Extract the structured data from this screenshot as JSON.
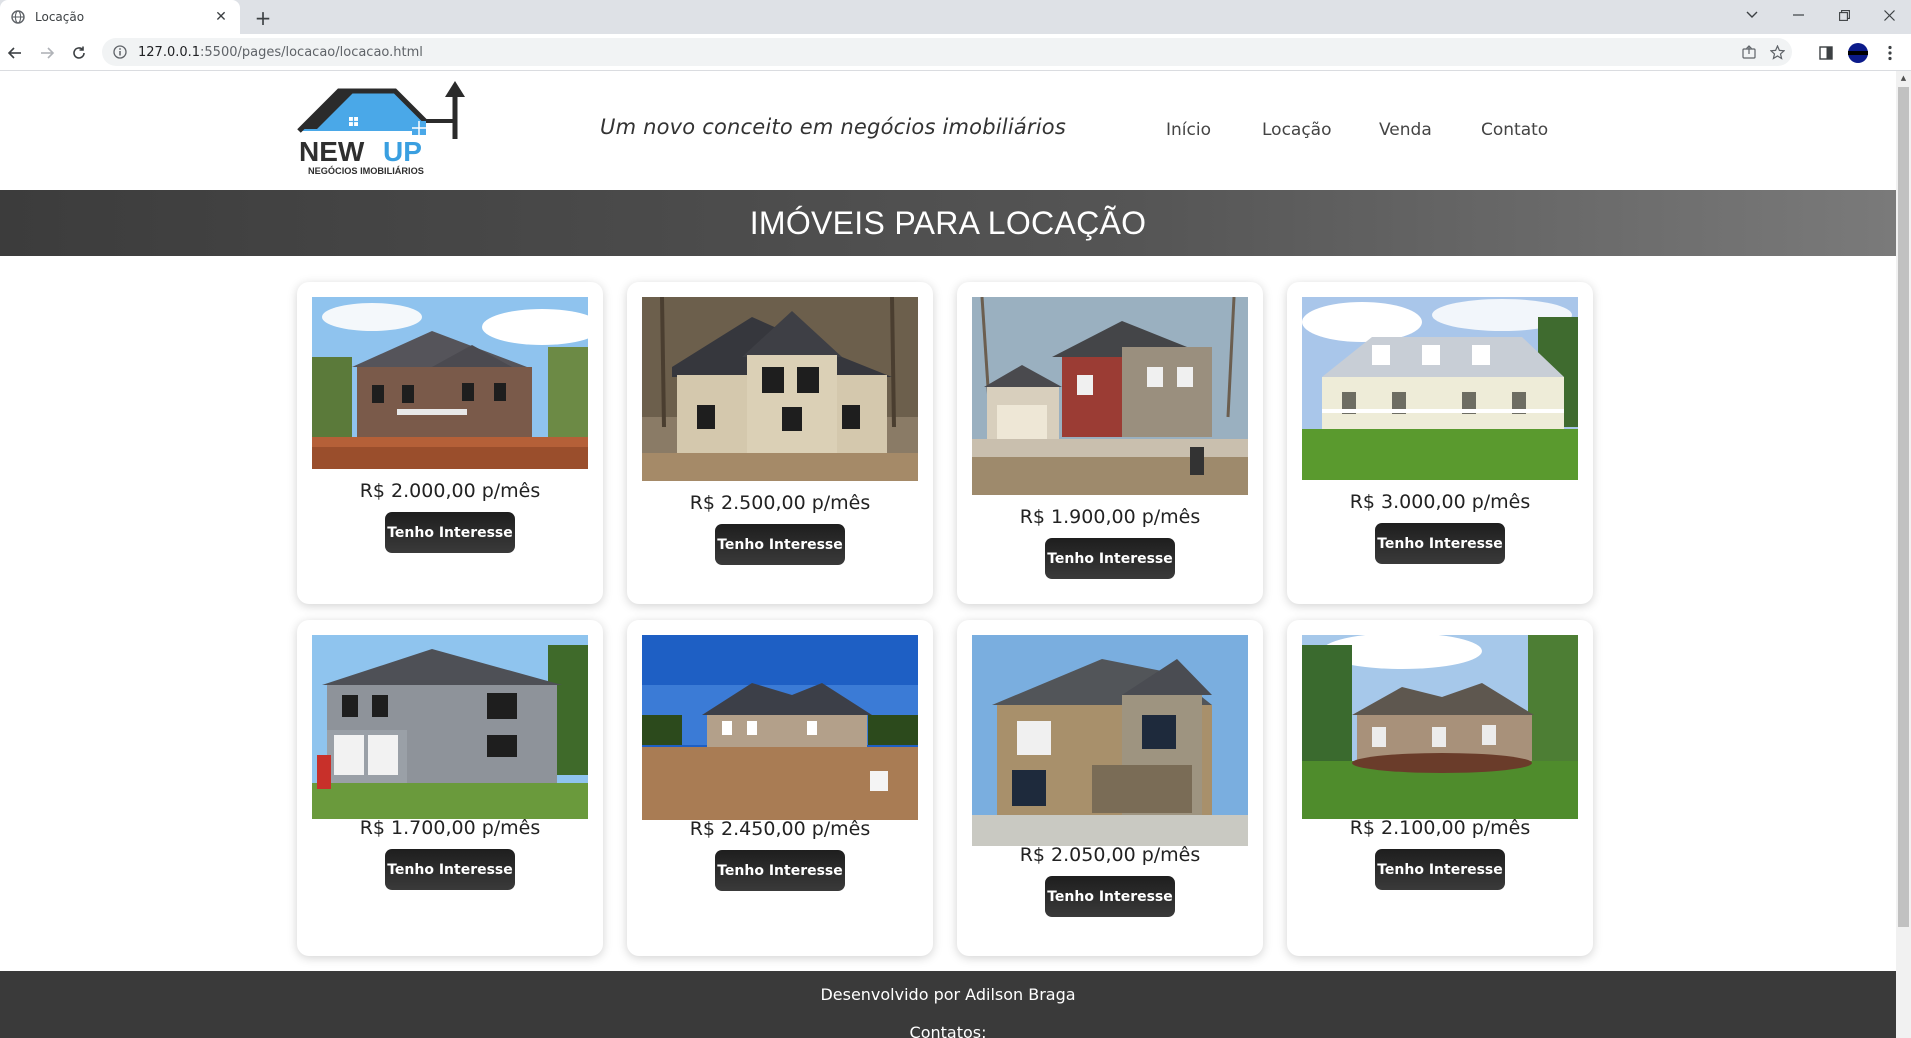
{
  "browser": {
    "tab_title": "Locação",
    "url_host": "127.0.0.1",
    "url_rest": ":5500/pages/locacao/locacao.html"
  },
  "header": {
    "logo_text_main": "NEW UP",
    "logo_text_sub": "NEGÓCIOS IMOBILIÁRIOS",
    "slogan": "Um novo conceito em negócios imobiliários",
    "nav": [
      "Início",
      "Locação",
      "Venda",
      "Contato"
    ]
  },
  "banner_title": "IMÓVEIS PARA LOCAÇÃO",
  "cards": [
    {
      "price": "R$ 2.000,00 p/mês",
      "button": "Tenho Interesse"
    },
    {
      "price": "R$ 2.500,00 p/mês",
      "button": "Tenho Interesse"
    },
    {
      "price": "R$ 1.900,00 p/mês",
      "button": "Tenho Interesse"
    },
    {
      "price": "R$ 3.000,00 p/mês",
      "button": "Tenho Interesse"
    },
    {
      "price": "R$ 1.700,00 p/mês",
      "button": "Tenho Interesse"
    },
    {
      "price": "R$ 2.450,00 p/mês",
      "button": "Tenho Interesse"
    },
    {
      "price": "R$ 2.050,00 p/mês",
      "button": "Tenho Interesse"
    },
    {
      "price": "R$ 2.100,00 p/mês",
      "button": "Tenho Interesse"
    }
  ],
  "footer": {
    "credit": "Desenvolvido por Adilson Braga",
    "contact": "Contatos:"
  }
}
